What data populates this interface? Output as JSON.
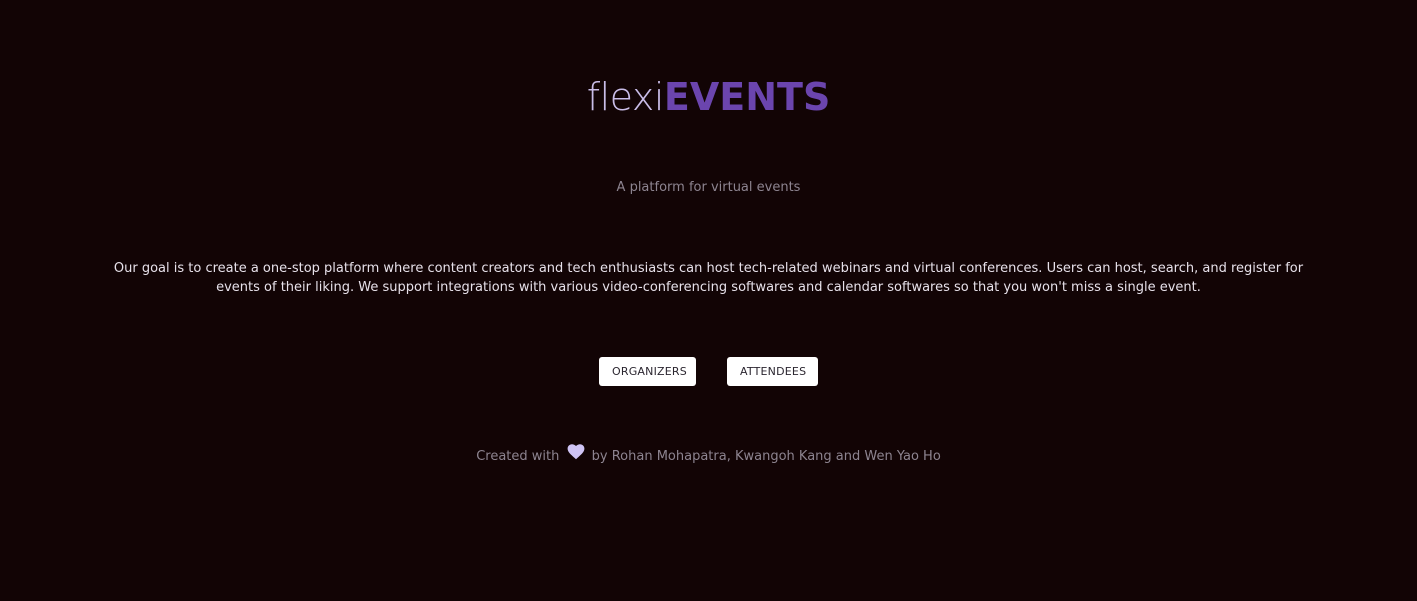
{
  "brand": {
    "light_part": "flexi",
    "bold_part": "EVENTS"
  },
  "tagline": "A platform for virtual events",
  "description": "Our goal is to create a one-stop platform where content creators and tech enthusiasts can host tech-related webinars and virtual conferences. Users can host, search, and register for events of their liking. We support integrations with various video-conferencing softwares and calendar softwares so that you won't miss a single event.",
  "buttons": {
    "organizers": "ORGANIZERS",
    "attendees": "ATTENDEES"
  },
  "footer": {
    "prefix": "Created with",
    "icon": "heart-icon",
    "suffix": "by Rohan Mohapatra, Kwangoh Kang and Wen Yao Ho"
  },
  "colors": {
    "background": "#120405",
    "accent": "#6b45ae",
    "accent_light": "#c9bde8",
    "heart": "#cfc4f5"
  }
}
